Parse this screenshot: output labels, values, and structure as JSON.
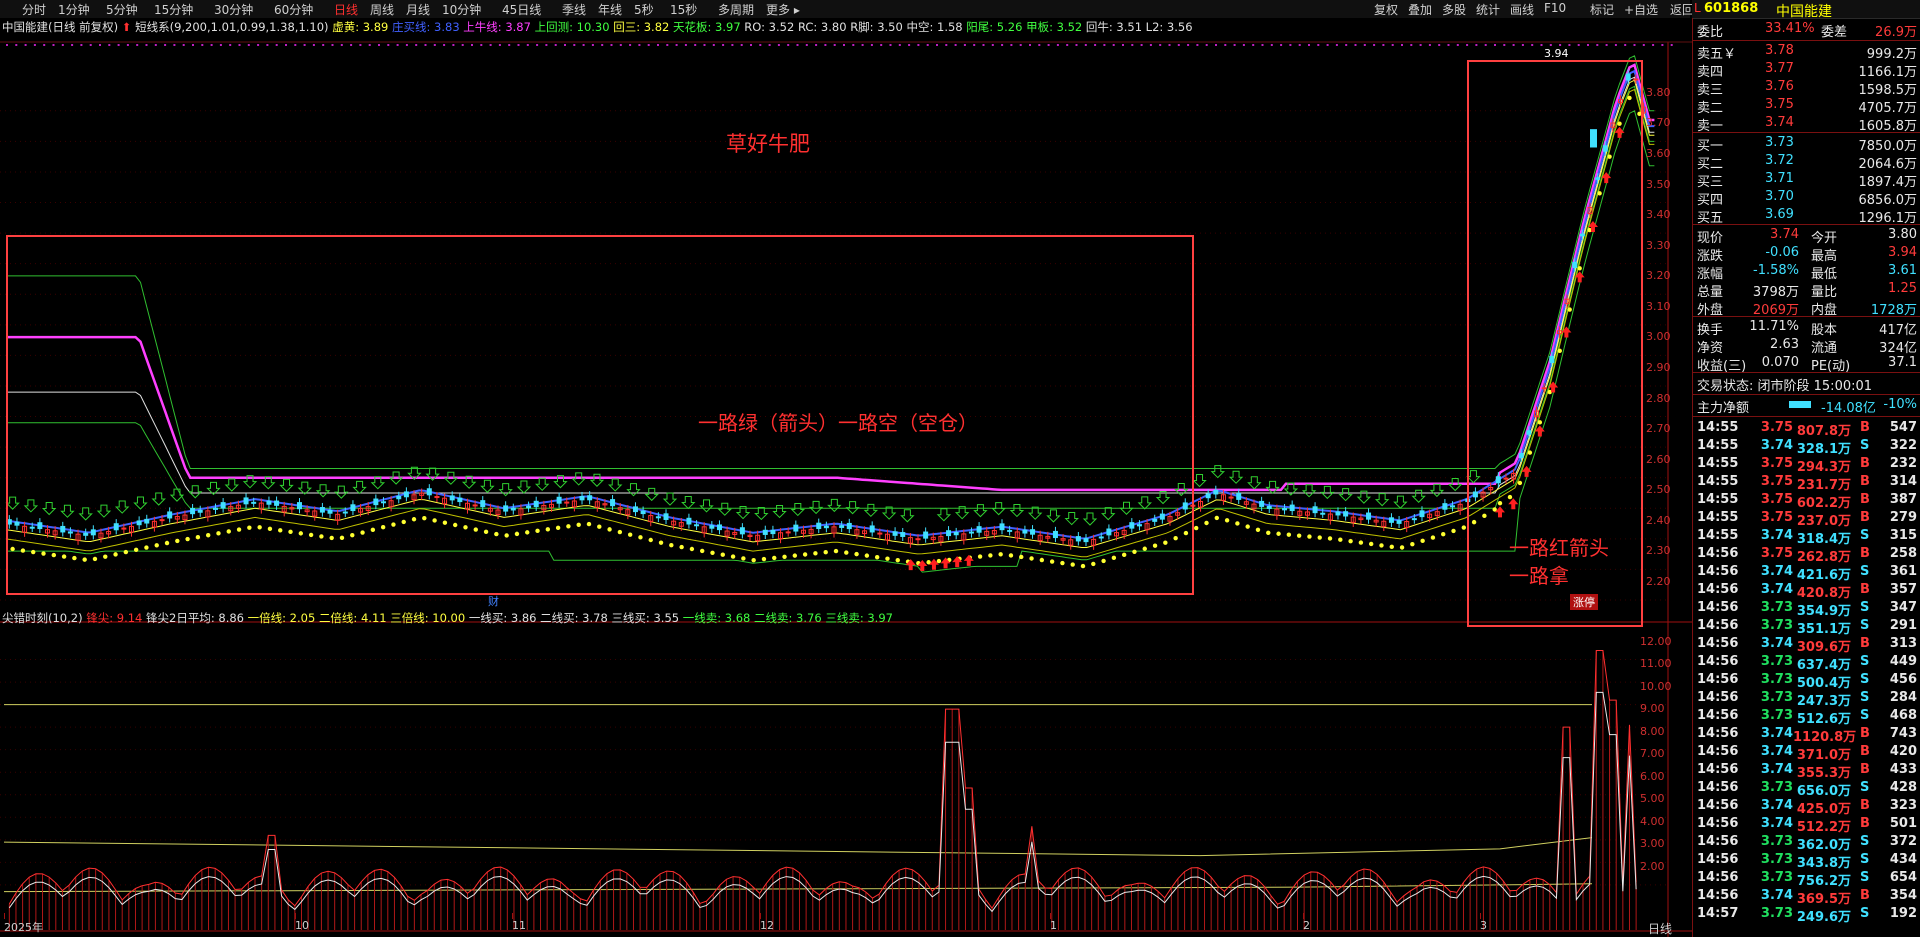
{
  "toolbar": {
    "periods": [
      "分时",
      "1分钟",
      "5分钟",
      "15分钟",
      "30分钟",
      "60分钟",
      "日线",
      "周线",
      "月线",
      "10分钟",
      "45日线",
      "季线",
      "年线",
      "5秒",
      "15秒",
      "多周期",
      "更多 ▸"
    ],
    "active_period": "日线",
    "actions": [
      "复权",
      "叠加",
      "多股",
      "统计",
      "画线",
      "F10",
      "标记",
      "+自选",
      "返回"
    ]
  },
  "stock": {
    "code": "601868",
    "name": "中国能建",
    "mark": "L"
  },
  "main_legend": {
    "title": "中国能建(日线 前复权)",
    "indicator": "短线系(9,200,1.01,0.99,1.38,1.10)",
    "items": [
      {
        "label": "虚黄: 3.89",
        "color": "#ffff40"
      },
      {
        "label": "庄买线: 3.83",
        "color": "#4060ff"
      },
      {
        "label": "上牛线: 3.87",
        "color": "#ff40ff"
      },
      {
        "label": "上回测: 10.30",
        "color": "#40ff40"
      },
      {
        "label": "回三: 3.82",
        "color": "#ffff40"
      },
      {
        "label": "天花板: 3.97",
        "color": "#40ff40"
      },
      {
        "label": "RO: 3.52",
        "color": "#e0e0e0"
      },
      {
        "label": "RC: 3.80",
        "color": "#e0e0e0"
      },
      {
        "label": "R脚: 3.50",
        "color": "#e0e0e0"
      },
      {
        "label": "中空: 1.58",
        "color": "#e0e0e0"
      },
      {
        "label": "阳尾: 5.26",
        "color": "#40ff40"
      },
      {
        "label": "甲板: 3.52",
        "color": "#40ff40"
      },
      {
        "label": "回牛: 3.51",
        "color": "#e0e0e0"
      },
      {
        "label": "L2: 3.56",
        "color": "#e0e0e0"
      }
    ]
  },
  "sub_legend": {
    "title": "尖错时刻(10,2)",
    "items": [
      {
        "label": "锋尖: 9.14",
        "color": "#ff3030"
      },
      {
        "label": "锋尖2日平均: 8.86",
        "color": "#e0e0e0"
      },
      {
        "label": "一倍线: 2.05",
        "color": "#ffff40"
      },
      {
        "label": "二倍线: 4.11",
        "color": "#ffff40"
      },
      {
        "label": "三倍线: 10.00",
        "color": "#ffff40"
      },
      {
        "label": "一线买: 3.86",
        "color": "#e0e0e0"
      },
      {
        "label": "二线买: 3.78",
        "color": "#e0e0e0"
      },
      {
        "label": "三线买: 3.55",
        "color": "#e0e0e0"
      },
      {
        "label": "一线卖: 3.68",
        "color": "#40ff40"
      },
      {
        "label": "二线卖: 3.76",
        "color": "#40ff40"
      },
      {
        "label": "三线卖: 3.97",
        "color": "#40ff40"
      }
    ]
  },
  "annotations": {
    "top": "草好牛肥",
    "middle": "一路绿（箭头）一路空（空仓）",
    "right1": "一路红箭头",
    "right2": "一路拿",
    "marker": "财",
    "badge": "涨停",
    "high": "3.94"
  },
  "main_axis": [
    "3.80",
    "3.70",
    "3.60",
    "3.50",
    "3.40",
    "3.30",
    "3.20",
    "3.10",
    "3.00",
    "2.90",
    "2.80",
    "2.70",
    "2.60",
    "2.50",
    "2.40",
    "2.30",
    "2.20"
  ],
  "sub_axis": [
    "12.00",
    "11.00",
    "10.00",
    "9.00",
    "8.00",
    "7.00",
    "6.00",
    "5.00",
    "4.00",
    "3.00",
    "2.00"
  ],
  "x_axis": [
    {
      "label": "2025年",
      "x": 4
    },
    {
      "label": "10",
      "x": 295
    },
    {
      "label": "11",
      "x": 512
    },
    {
      "label": "12",
      "x": 760
    },
    {
      "label": "1",
      "x": 1050
    },
    {
      "label": "2",
      "x": 1303
    },
    {
      "label": "3",
      "x": 1480
    }
  ],
  "x_axis_right": "日线",
  "panel": {
    "weibi": {
      "label": "委比",
      "value": "33.41%",
      "diff_label": "委差",
      "diff": "26.9万"
    },
    "asks": [
      {
        "label": "卖五￥",
        "price": "3.78",
        "vol": "999.2万"
      },
      {
        "label": "卖四",
        "price": "3.77",
        "vol": "1166.1万"
      },
      {
        "label": "卖三",
        "price": "3.76",
        "vol": "1598.5万"
      },
      {
        "label": "卖二",
        "price": "3.75",
        "vol": "4705.7万"
      },
      {
        "label": "卖一",
        "price": "3.74",
        "vol": "1605.8万"
      }
    ],
    "bids": [
      {
        "label": "买一",
        "price": "3.73",
        "vol": "7850.0万"
      },
      {
        "label": "买二",
        "price": "3.72",
        "vol": "2064.6万"
      },
      {
        "label": "买三",
        "price": "3.71",
        "vol": "1897.4万"
      },
      {
        "label": "买四",
        "price": "3.70",
        "vol": "6856.0万"
      },
      {
        "label": "买五",
        "price": "3.69",
        "vol": "1296.1万"
      }
    ],
    "quote": [
      {
        "l1": "现价",
        "v1": "3.74",
        "c1": "red",
        "l2": "今开",
        "v2": "3.80",
        "c2": "wht"
      },
      {
        "l1": "涨跌",
        "v1": "-0.06",
        "c1": "cyn",
        "l2": "最高",
        "v2": "3.94",
        "c2": "red"
      },
      {
        "l1": "涨幅",
        "v1": "-1.58%",
        "c1": "cyn",
        "l2": "最低",
        "v2": "3.61",
        "c2": "cyn"
      },
      {
        "l1": "总量",
        "v1": "3798万",
        "c1": "wht",
        "l2": "量比",
        "v2": "1.25",
        "c2": "red"
      },
      {
        "l1": "外盘",
        "v1": "2069万",
        "c1": "red",
        "l2": "内盘",
        "v2": "1728万",
        "c2": "cyn"
      }
    ],
    "fin": [
      {
        "l1": "换手",
        "v1": "11.71%",
        "l2": "股本",
        "v2": "417亿"
      },
      {
        "l1": "净资",
        "v1": "2.63",
        "l2": "流通",
        "v2": "324亿"
      },
      {
        "l1": "收益(三)",
        "v1": "0.070",
        "l2": "PE(动)",
        "v2": "37.1"
      }
    ],
    "status": "交易状态: 闭市阶段 15:00:01",
    "net": {
      "label": "主力净额",
      "value": "-14.08亿",
      "pct": "-10%"
    },
    "ticks": [
      [
        "14:55",
        "3.75",
        "807.8万",
        "B",
        "547"
      ],
      [
        "14:55",
        "3.74",
        "328.1万",
        "S",
        "322"
      ],
      [
        "14:55",
        "3.75",
        "294.3万",
        "B",
        "232"
      ],
      [
        "14:55",
        "3.75",
        "231.7万",
        "B",
        "314"
      ],
      [
        "14:55",
        "3.75",
        "602.2万",
        "B",
        "387"
      ],
      [
        "14:55",
        "3.75",
        "237.0万",
        "B",
        "279"
      ],
      [
        "14:55",
        "3.74",
        "318.4万",
        "S",
        "315"
      ],
      [
        "14:56",
        "3.75",
        "262.8万",
        "B",
        "258"
      ],
      [
        "14:56",
        "3.74",
        "421.6万",
        "S",
        "361"
      ],
      [
        "14:56",
        "3.74",
        "420.8万",
        "B",
        "357"
      ],
      [
        "14:56",
        "3.73",
        "354.9万",
        "S",
        "347"
      ],
      [
        "14:56",
        "3.73",
        "351.1万",
        "S",
        "291"
      ],
      [
        "14:56",
        "3.74",
        "309.6万",
        "B",
        "313"
      ],
      [
        "14:56",
        "3.73",
        "637.4万",
        "S",
        "449"
      ],
      [
        "14:56",
        "3.73",
        "500.4万",
        "S",
        "456"
      ],
      [
        "14:56",
        "3.73",
        "247.3万",
        "S",
        "284"
      ],
      [
        "14:56",
        "3.73",
        "512.6万",
        "S",
        "468"
      ],
      [
        "14:56",
        "3.74",
        "1120.8万",
        "B",
        "743"
      ],
      [
        "14:56",
        "3.74",
        "371.0万",
        "B",
        "420"
      ],
      [
        "14:56",
        "3.74",
        "355.3万",
        "B",
        "433"
      ],
      [
        "14:56",
        "3.73",
        "656.0万",
        "S",
        "428"
      ],
      [
        "14:56",
        "3.74",
        "425.0万",
        "B",
        "323"
      ],
      [
        "14:56",
        "3.74",
        "512.2万",
        "B",
        "501"
      ],
      [
        "14:56",
        "3.73",
        "362.0万",
        "S",
        "372"
      ],
      [
        "14:56",
        "3.73",
        "343.8万",
        "S",
        "434"
      ],
      [
        "14:56",
        "3.73",
        "756.2万",
        "S",
        "654"
      ],
      [
        "14:56",
        "3.74",
        "369.5万",
        "B",
        "354"
      ],
      [
        "14:57",
        "3.73",
        "249.6万",
        "S",
        "192"
      ]
    ]
  },
  "chart_data": [
    {
      "type": "candlestick",
      "title": "中国能建(日线 前复权)",
      "ylim": [
        2.2,
        3.94
      ],
      "series": [
        {
          "name": "上牛线",
          "color": "#ff40ff",
          "values": [
            [
              0,
              2.74
            ],
            [
              0.24,
              2.74
            ],
            [
              0.52,
              2.64
            ],
            [
              0.58,
              2.58
            ],
            [
              0.85,
              2.58
            ],
            [
              0.94,
              2.74
            ],
            [
              1.0,
              2.74
            ]
          ]
        }
      ],
      "prices": [
        {
          "x": 0.0,
          "v": 2.45
        },
        {
          "x": 0.05,
          "v": 2.41
        },
        {
          "x": 0.1,
          "v": 2.47
        },
        {
          "x": 0.15,
          "v": 2.52
        },
        {
          "x": 0.2,
          "v": 2.48
        },
        {
          "x": 0.25,
          "v": 2.55
        },
        {
          "x": 0.3,
          "v": 2.49
        },
        {
          "x": 0.35,
          "v": 2.53
        },
        {
          "x": 0.4,
          "v": 2.46
        },
        {
          "x": 0.45,
          "v": 2.41
        },
        {
          "x": 0.5,
          "v": 2.44
        },
        {
          "x": 0.55,
          "v": 2.4
        },
        {
          "x": 0.6,
          "v": 2.43
        },
        {
          "x": 0.65,
          "v": 2.39
        },
        {
          "x": 0.7,
          "v": 2.47
        },
        {
          "x": 0.73,
          "v": 2.55
        },
        {
          "x": 0.76,
          "v": 2.5
        },
        {
          "x": 0.8,
          "v": 2.48
        },
        {
          "x": 0.84,
          "v": 2.45
        },
        {
          "x": 0.88,
          "v": 2.52
        },
        {
          "x": 0.91,
          "v": 2.62
        },
        {
          "x": 0.93,
          "v": 2.95
        },
        {
          "x": 0.95,
          "v": 3.4
        },
        {
          "x": 0.97,
          "v": 3.8
        },
        {
          "x": 0.98,
          "v": 3.94
        },
        {
          "x": 0.99,
          "v": 3.74
        }
      ]
    },
    {
      "type": "bar",
      "title": "尖错时刻(10,2)",
      "ylim": [
        0,
        12.6
      ]
    }
  ]
}
